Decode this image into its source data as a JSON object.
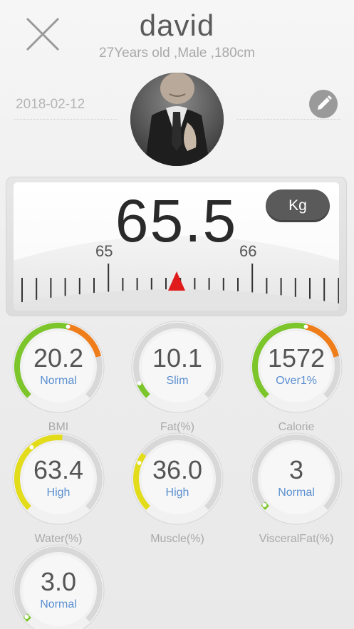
{
  "header": {
    "name": "david",
    "info": "27Years old ,Male ,180cm",
    "date": "2018-02-12"
  },
  "scale": {
    "weight": "65.5",
    "unit": "Kg",
    "tick_left": "65",
    "tick_right": "66",
    "pointer_color": "#e01b1b"
  },
  "metrics": [
    {
      "value": "20.2",
      "status": "Normal",
      "label": "BMI",
      "level": 0.55
    },
    {
      "value": "10.1",
      "status": "Slim",
      "label": "Fat(%)",
      "level": 0.08
    },
    {
      "value": "1572",
      "status": "Over1%",
      "label": "Calorie",
      "level": 0.55
    },
    {
      "value": "63.4",
      "status": "High",
      "label": "Water(%)",
      "level": 0.35
    },
    {
      "value": "36.0",
      "status": "High",
      "label": "Muscle(%)",
      "level": 0.25
    },
    {
      "value": "3",
      "status": "Normal",
      "label": "VisceralFat(%)",
      "level": 0.02
    },
    {
      "value": "3.0",
      "status": "Normal",
      "label": "",
      "level": 0.02
    }
  ],
  "colors": {
    "status_text": "#5b8fd0",
    "arc_green": "#7cc52a",
    "arc_yellow": "#e2dc1a",
    "arc_orange": "#ef7d1a",
    "track": "#d8d8d8"
  },
  "icons": {
    "close": "close-icon",
    "edit": "pencil-icon",
    "avatar": "avatar-photo"
  }
}
